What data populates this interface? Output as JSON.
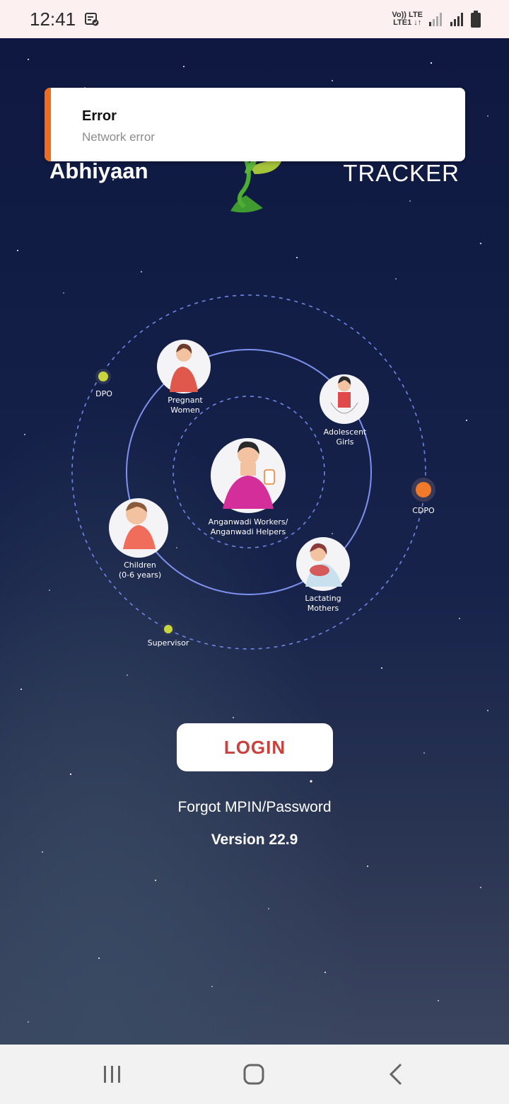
{
  "status_bar": {
    "time": "12:41",
    "network_top": "Vo)) LTE",
    "network_bottom": "LTE1 ↓↑",
    "icons": [
      "notification-icon",
      "signal-icon",
      "signal-icon",
      "battery-icon"
    ]
  },
  "toast": {
    "title": "Error",
    "message": "Network error",
    "accent_color": "#f26a1b"
  },
  "header": {
    "brand_left": "Abhiyaan",
    "brand_right": "TRACKER"
  },
  "diagram": {
    "center_label_line1": "Anganwadi Workers/",
    "center_label_line2": "Anganwadi Helpers",
    "nodes": {
      "pregnant_women": [
        "Pregnant",
        "Women"
      ],
      "adolescent_girls": [
        "Adolescent",
        "Girls"
      ],
      "children": [
        "Children",
        "(0-6 years)"
      ],
      "lactating_mothers": [
        "Lactating",
        "Mothers"
      ]
    },
    "officials": {
      "dpo": "DPO",
      "cdpo": "CDPO",
      "supervisor": "Supervisor"
    },
    "colors": {
      "dot_yellow": "#c8d63b",
      "dot_orange": "#f07a2a",
      "ring": "#6f86e6"
    }
  },
  "actions": {
    "login_label": "LOGIN",
    "forgot_label": "Forgot MPIN/Password",
    "version_label": "Version 22.9",
    "login_text_color": "#c9403c"
  },
  "nav_bar": {
    "icons": [
      "recent-apps-icon",
      "home-icon",
      "back-icon"
    ]
  }
}
